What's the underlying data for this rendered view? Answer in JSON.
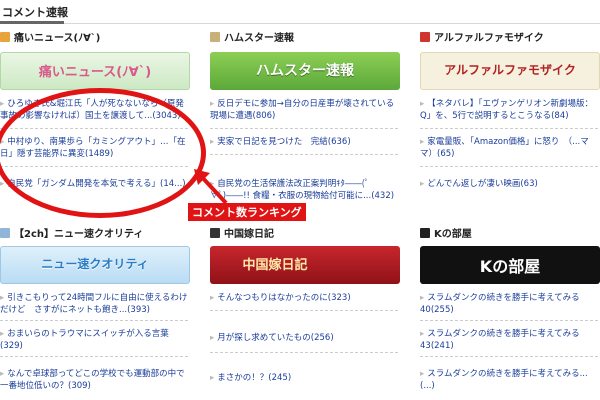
{
  "section": {
    "title": "コメント速報"
  },
  "columns": [
    {
      "title": "痛いニュース(ﾉ∀`)",
      "icon": "news-site-icon",
      "banner": "痛いニュース(ﾉ∀`)",
      "items": [
        "ひろゆき氏&堀江氏「人が死なないなら（原発事故の影響なければ）国土を譲渡して...(3043)",
        "中村ゆり、南果歩ら「カミングアウト」…「在日」隠す芸能界に異変(1489)",
        "自民党「ガンダム開発を本気で考える」(14...)"
      ]
    },
    {
      "title": "ハムスター速報",
      "icon": "hamster-site-icon",
      "banner": "ハムスター速報",
      "items": [
        "反日デモに参加→自分の日産車が壊されている現場に遭遇(806)",
        "実家で日記を見つけた　完結(636)",
        "自民党の生活保護法改正案判明ｷﾀ――(ﾟ∀ﾟ)――!! 食糧・衣服の現物給付可能に...(432)"
      ]
    },
    {
      "title": "アルファルファモザイク",
      "icon": "alpha-site-icon",
      "banner": "アルファルファモザイク",
      "items": [
        "【ネタバレ】「エヴァンゲリオン新劇場版：Q」を、5行で説明するとこうなる(84)",
        "家電量販、「Amazon価格」に怒り　（...ママ）(65)",
        "どんでん返しが凄い映画(63)"
      ]
    },
    {
      "title": "【2ch】ニュー速クオリティ",
      "icon": "2ch-site-icon",
      "banner": "ニュー速クオリティ",
      "items": [
        "引きこもりって24時間フルに自由に使えるわけだけど　さすがにネットも飽き...(393)",
        "おまいらのトラウマにスイッチが入る言葉(329)",
        "なんで卓球部ってどこの学校でも運動部の中で一番地位低いの？(309)"
      ]
    },
    {
      "title": "中国嫁日記",
      "icon": "china-wife-site-icon",
      "banner": "中国嫁日記",
      "items": [
        "そんなつもりはなかったのに(323)",
        "月が探し求めていたもの(256)",
        "まさかの！？(245)"
      ]
    },
    {
      "title": "Kの部屋",
      "icon": "k-room-site-icon",
      "banner": "Kの部屋",
      "items": [
        "スラムダンクの続きを勝手に考えてみる40(255)",
        "スラムダンクの続きを勝手に考えてみる43(241)",
        "スラムダンクの続きを勝手に考えてみる...(...)"
      ]
    }
  ],
  "annotation": {
    "label": "コメント数ランキング",
    "color": "#e01414"
  },
  "colors": {
    "link": "#1a3d9a",
    "accent": "#e01414"
  }
}
